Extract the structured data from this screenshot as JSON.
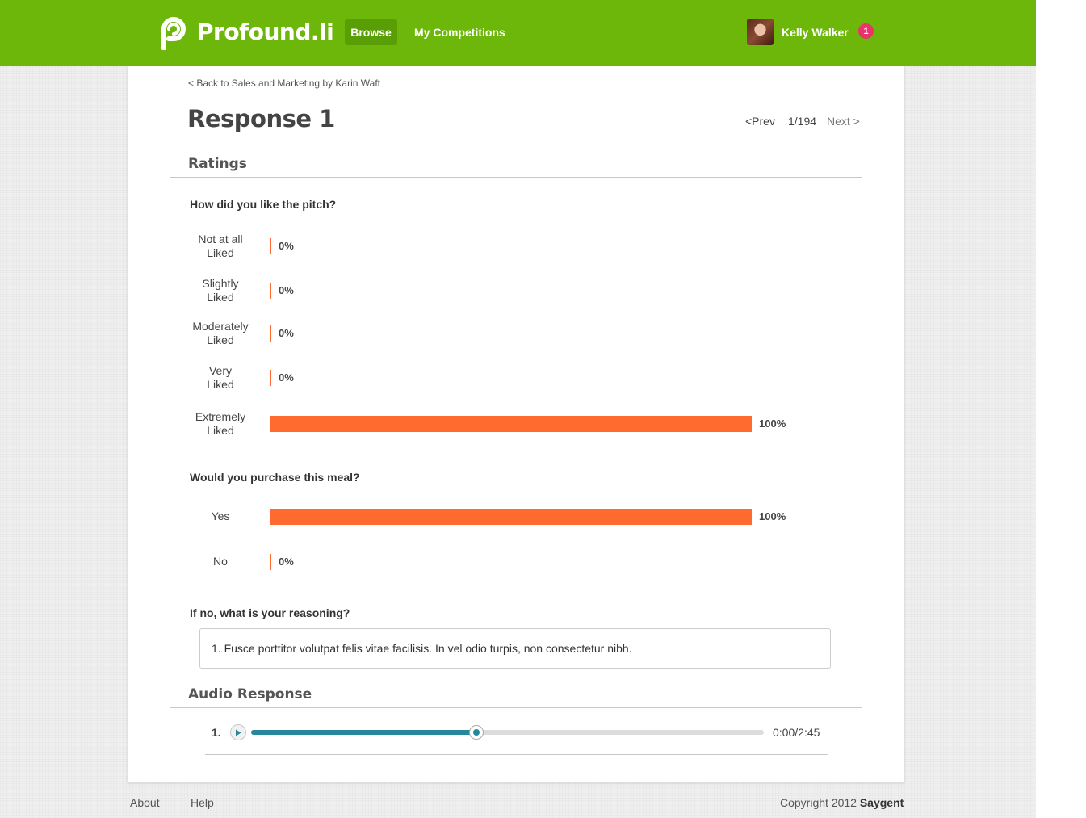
{
  "brand": {
    "name": "Profound.li",
    "accent": "#6db70a"
  },
  "nav": {
    "browse": "Browse",
    "competitions": "My Competitions"
  },
  "user": {
    "name": "Kelly Walker",
    "notifications": "1"
  },
  "page": {
    "back_link": "< Back to Sales and Marketing by Karin Waft",
    "title": "Response 1",
    "pager": {
      "prev": "<Prev",
      "position": "1/194",
      "next": "Next >"
    }
  },
  "ratings": {
    "section_title": "Ratings",
    "bar_color": "#ff6b2f",
    "questions": [
      {
        "question": "How did you like the pitch?",
        "rows": [
          {
            "label_line1": "Not at all",
            "label_line2": "Liked",
            "value": 0,
            "pct": "0%"
          },
          {
            "label_line1": "Slightly",
            "label_line2": "Liked",
            "value": 0,
            "pct": "0%"
          },
          {
            "label_line1": "Moderately",
            "label_line2": "Liked",
            "value": 0,
            "pct": "0%"
          },
          {
            "label_line1": "Very",
            "label_line2": "Liked",
            "value": 0,
            "pct": "0%"
          },
          {
            "label_line1": "Extremely",
            "label_line2": "Liked",
            "value": 100,
            "pct": "100%"
          }
        ]
      },
      {
        "question": "Would you purchase this meal?",
        "rows": [
          {
            "label_line1": "Yes",
            "label_line2": "",
            "value": 100,
            "pct": "100%"
          },
          {
            "label_line1": "No",
            "label_line2": "",
            "value": 0,
            "pct": "0%"
          }
        ]
      }
    ],
    "reasoning": {
      "question": "If no, what is your reasoning?",
      "answer": "1. Fusce porttitor volutpat felis vitae facilisis. In vel odio turpis, non consectetur nibh."
    }
  },
  "audio": {
    "section_title": "Audio Response",
    "item_number": "1.",
    "time": "0:00/2:45",
    "progress": 0.44,
    "progress_color": "#26879a"
  },
  "footer": {
    "about": "About",
    "help": "Help",
    "copyright_prefix": "Copyright 2012",
    "copyright_brand": "Saygent"
  }
}
